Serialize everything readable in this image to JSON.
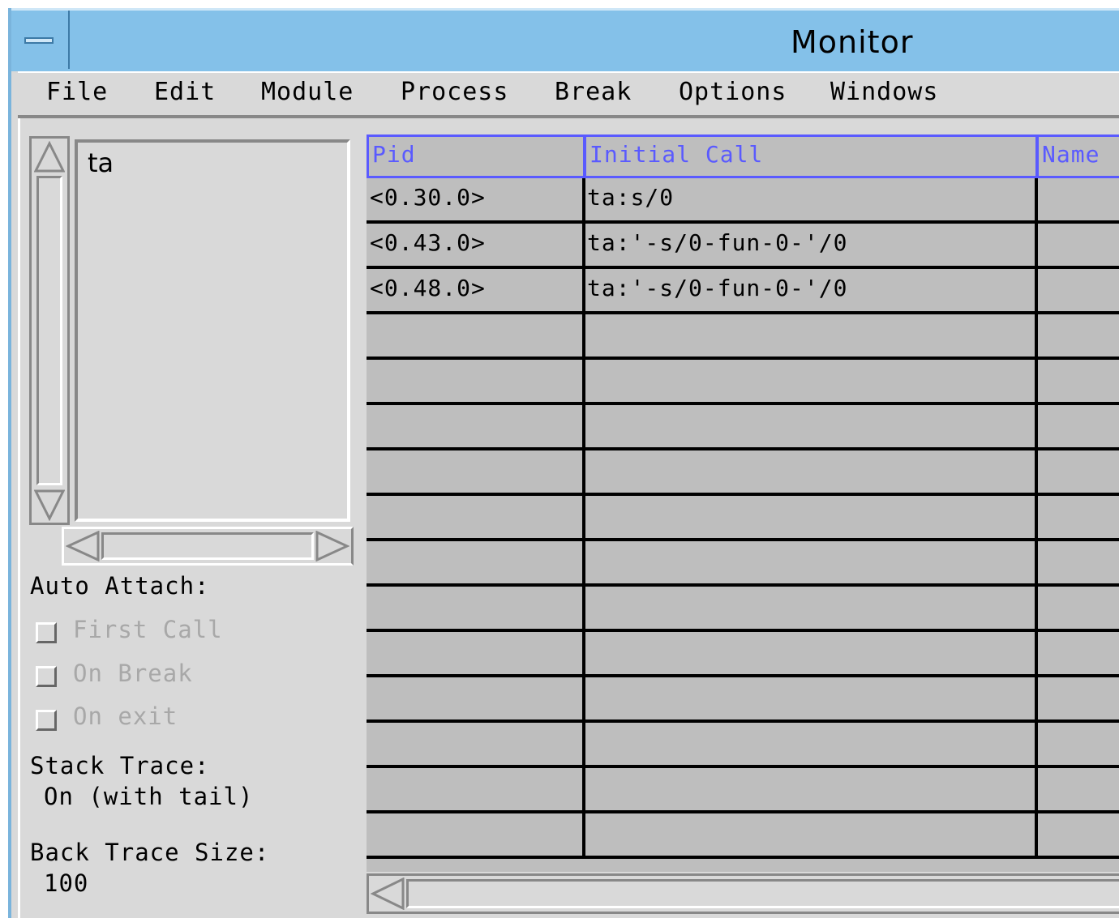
{
  "window": {
    "title": "Monitor"
  },
  "menubar": [
    "File",
    "Edit",
    "Module",
    "Process",
    "Break",
    "Options",
    "Windows"
  ],
  "module_list": {
    "items": [
      "ta"
    ]
  },
  "auto_attach": {
    "label": "Auto Attach:",
    "options": [
      {
        "label": "First Call",
        "checked": false,
        "enabled": false
      },
      {
        "label": "On Break",
        "checked": false,
        "enabled": false
      },
      {
        "label": "On exit",
        "checked": false,
        "enabled": false
      }
    ]
  },
  "stack_trace": {
    "label": "Stack Trace:",
    "value": "On (with tail)"
  },
  "back_trace": {
    "label": "Back Trace Size:",
    "value": "100"
  },
  "process_table": {
    "columns": [
      "Pid",
      "Initial Call",
      "Name"
    ],
    "rows": [
      [
        "<0.30.0>",
        "ta:s/0",
        ""
      ],
      [
        "<0.43.0>",
        "ta:'-s/0-fun-0-'/0",
        ""
      ],
      [
        "<0.48.0>",
        "ta:'-s/0-fun-0-'/0",
        ""
      ]
    ],
    "empty_rows": 12
  },
  "colors": {
    "title_bg": "#84c1e9",
    "header_text": "#5a5aff",
    "table_bg": "#bebebe",
    "window_bg": "#d9d9d9"
  }
}
